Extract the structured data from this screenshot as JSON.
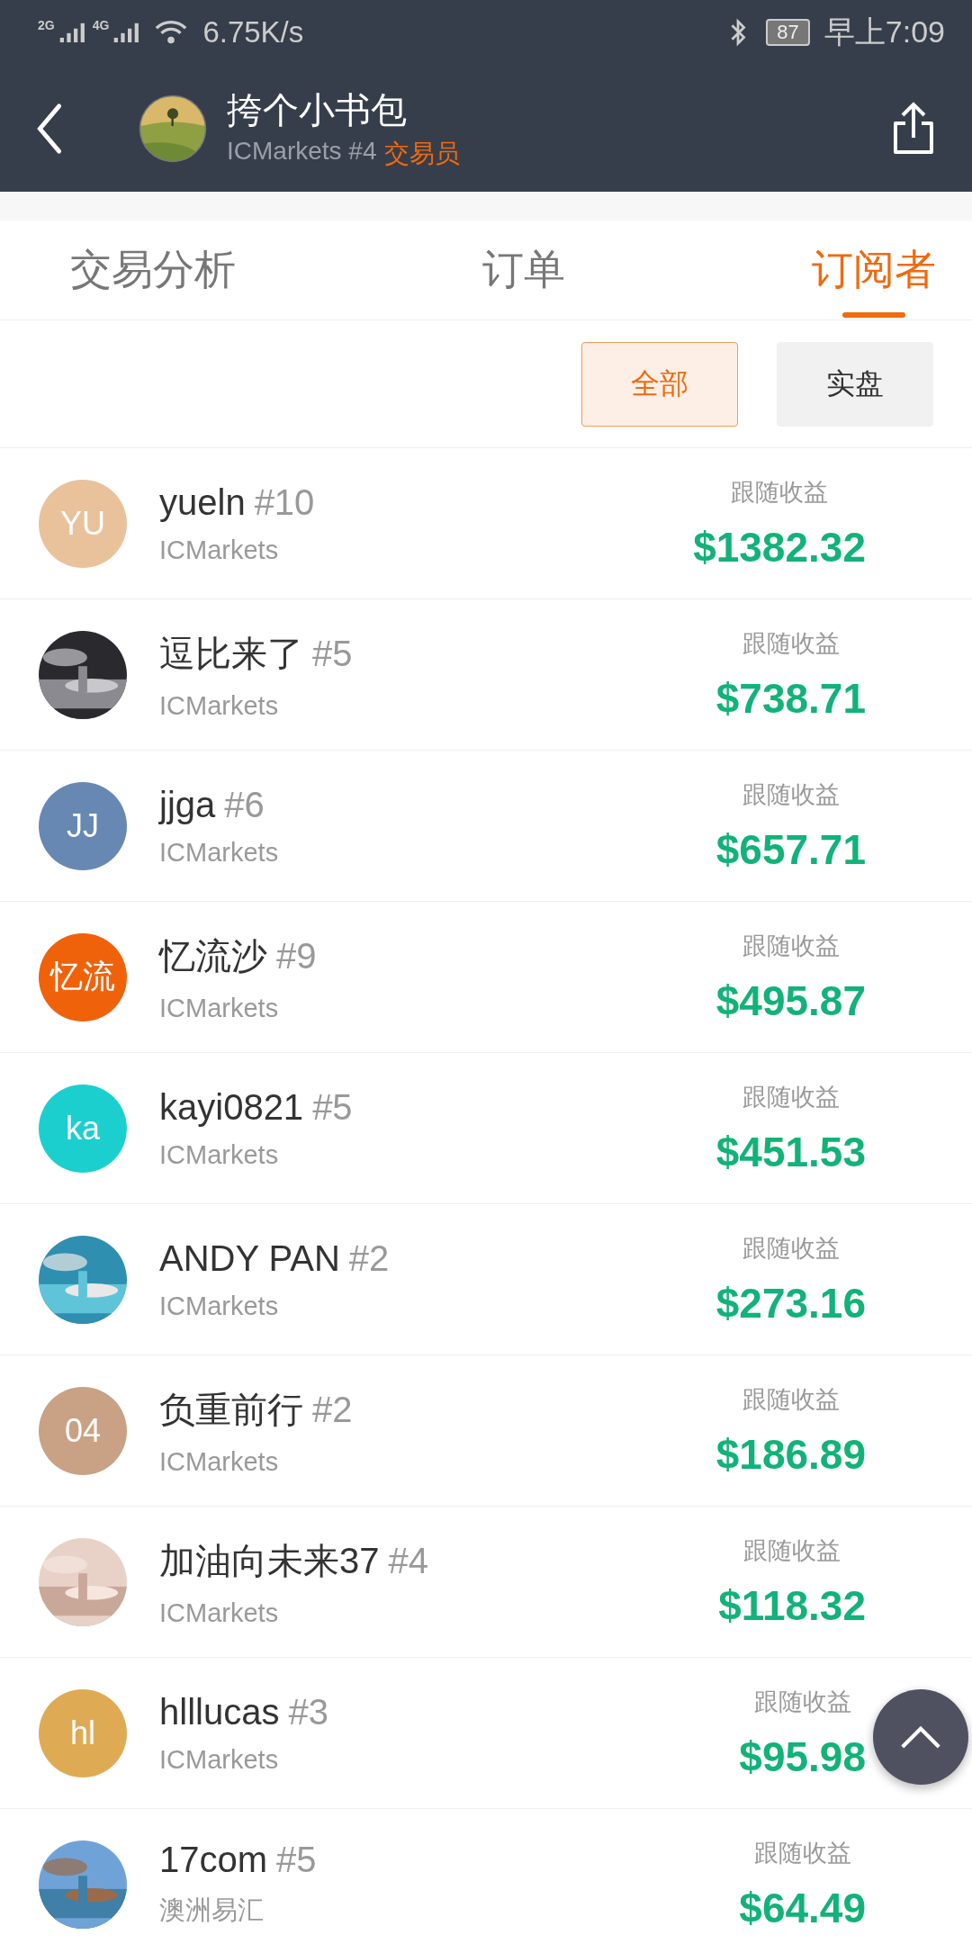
{
  "status_bar": {
    "network_1": "2G",
    "network_2": "4G",
    "speed": "6.75K/s",
    "battery": "87",
    "time": "早上7:09"
  },
  "header": {
    "name": "挎个小书包",
    "broker": "ICMarkets #4",
    "role": "交易员"
  },
  "tabs": [
    {
      "label": "交易分析",
      "selected": false
    },
    {
      "label": "订单",
      "selected": false
    },
    {
      "label": "订阅者",
      "selected": true
    }
  ],
  "filters": [
    {
      "label": "全部",
      "selected": true
    },
    {
      "label": "实盘",
      "selected": false
    }
  ],
  "subscribers": [
    {
      "avatar": {
        "kind": "letter",
        "text": "YU",
        "color": "#e9c29b"
      },
      "name": "yueln",
      "rank": "#10",
      "broker": "ICMarkets",
      "profit_label": "跟随收益",
      "profit": "$1382.32"
    },
    {
      "name": "逗比来了",
      "rank": "#5",
      "broker": "ICMarkets",
      "profit_label": "跟随收益",
      "profit": "$738.71"
    },
    {
      "avatar": {
        "kind": "letter",
        "text": "JJ",
        "color": "#6788b3"
      },
      "name": "jjga",
      "rank": "#6",
      "broker": "ICMarkets",
      "profit_label": "跟随收益",
      "profit": "$657.71"
    },
    {
      "avatar": {
        "kind": "letter",
        "text": "忆流",
        "color": "#f0620a"
      },
      "name": "忆流沙",
      "rank": "#9",
      "broker": "ICMarkets",
      "profit_label": "跟随收益",
      "profit": "$495.87"
    },
    {
      "avatar": {
        "kind": "letter",
        "text": "ka",
        "color": "#1ccfcf"
      },
      "name": "kayi0821",
      "rank": "#5",
      "broker": "ICMarkets",
      "profit_label": "跟随收益",
      "profit": "$451.53"
    },
    {
      "name": "ANDY PAN",
      "rank": "#2",
      "broker": "ICMarkets",
      "profit_label": "跟随收益",
      "profit": "$273.16"
    },
    {
      "avatar": {
        "kind": "letter",
        "text": "04",
        "color": "#c9a184"
      },
      "name": "负重前行",
      "rank": "#2",
      "broker": "ICMarkets",
      "profit_label": "跟随收益",
      "profit": "$186.89"
    },
    {
      "name": "加油向未来37",
      "rank": "#4",
      "broker": "ICMarkets",
      "profit_label": "跟随收益",
      "profit": "$118.32"
    },
    {
      "avatar": {
        "kind": "letter",
        "text": "hl",
        "color": "#deab54"
      },
      "name": "hlllucas",
      "rank": "#3",
      "broker": "ICMarkets",
      "profit_label": "跟随收益",
      "profit": "$95.98"
    },
    {
      "name": "17com",
      "rank": "#5",
      "broker": "澳洲易汇",
      "profit_label": "跟随收益",
      "profit": "$64.49"
    }
  ]
}
